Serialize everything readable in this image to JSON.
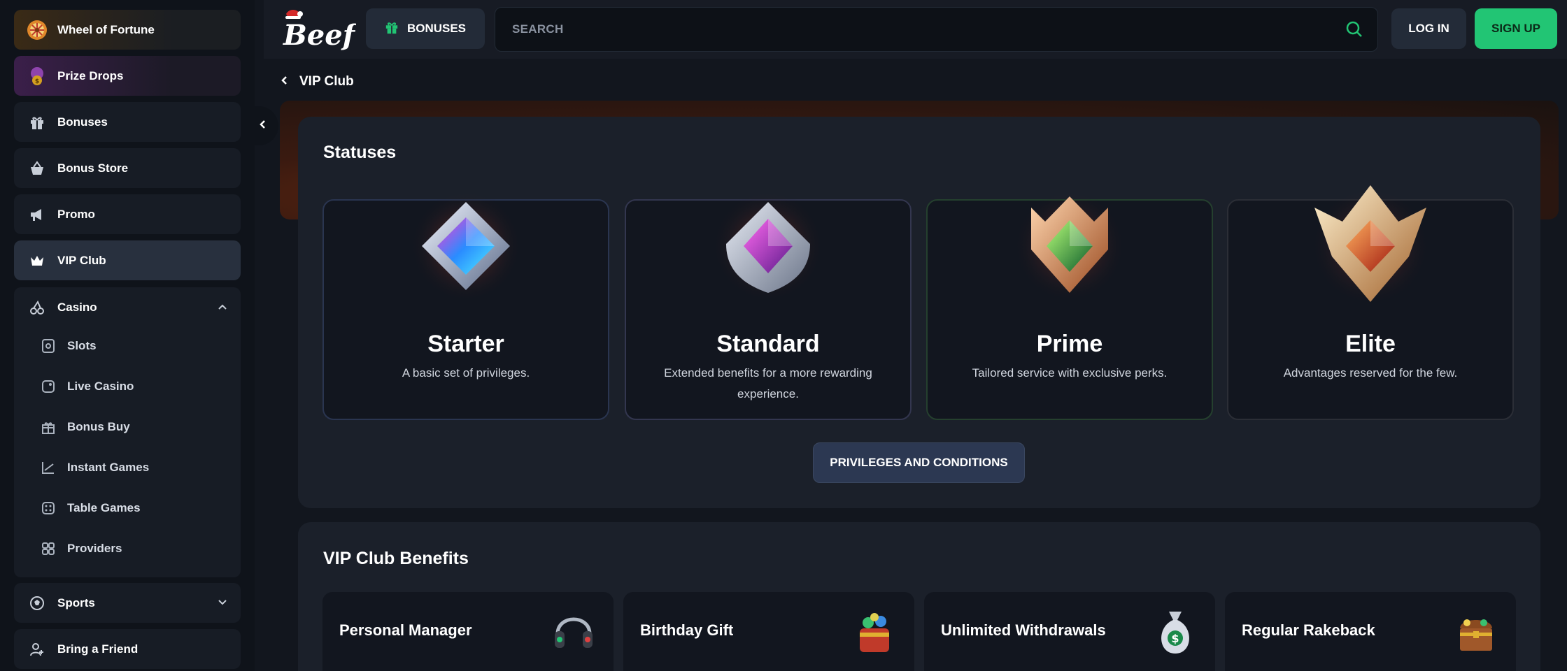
{
  "sidebar": {
    "items": [
      {
        "label": "Wheel of Fortune",
        "icon": "wheel-icon"
      },
      {
        "label": "Prize Drops",
        "icon": "coin-bag-icon"
      },
      {
        "label": "Bonuses",
        "icon": "gift-icon"
      },
      {
        "label": "Bonus Store",
        "icon": "basket-icon"
      },
      {
        "label": "Promo",
        "icon": "megaphone-icon"
      },
      {
        "label": "VIP Club",
        "icon": "crown-icon"
      }
    ],
    "casino": {
      "label": "Casino",
      "sub": [
        {
          "label": "Slots",
          "icon": "slot-icon"
        },
        {
          "label": "Live Casino",
          "icon": "live-icon"
        },
        {
          "label": "Bonus Buy",
          "icon": "gift-icon"
        },
        {
          "label": "Instant Games",
          "icon": "chart-icon"
        },
        {
          "label": "Table Games",
          "icon": "dice-icon"
        },
        {
          "label": "Providers",
          "icon": "grid-icon"
        }
      ]
    },
    "sports": {
      "label": "Sports"
    },
    "friend": {
      "label": "Bring a Friend"
    }
  },
  "header": {
    "logo": "Beef",
    "bonuses_label": "BONUSES",
    "search_placeholder": "SEARCH",
    "login_label": "LOG IN",
    "signup_label": "SIGN UP"
  },
  "main": {
    "breadcrumb": "VIP Club",
    "statuses_title": "Statuses",
    "statuses": [
      {
        "name": "Starter",
        "desc": "A basic set of privileges."
      },
      {
        "name": "Standard",
        "desc": "Extended benefits for a more rewarding experience."
      },
      {
        "name": "Prime",
        "desc": "Tailored service with exclusive perks."
      },
      {
        "name": "Elite",
        "desc": "Advantages reserved for the few."
      }
    ],
    "privileges_label": "PRIVILEGES AND CONDITIONS",
    "benefits_title": "VIP Club Benefits",
    "benefits": [
      {
        "title": "Personal Manager",
        "icon": "headphones-icon"
      },
      {
        "title": "Birthday Gift",
        "icon": "gift-bag-icon"
      },
      {
        "title": "Unlimited Withdrawals",
        "icon": "money-bag-icon"
      },
      {
        "title": "Regular Rakeback",
        "icon": "treasure-chest-icon"
      }
    ]
  },
  "colors": {
    "accent_green": "#22c574",
    "panel": "#1b202a",
    "card": "#12161f"
  }
}
